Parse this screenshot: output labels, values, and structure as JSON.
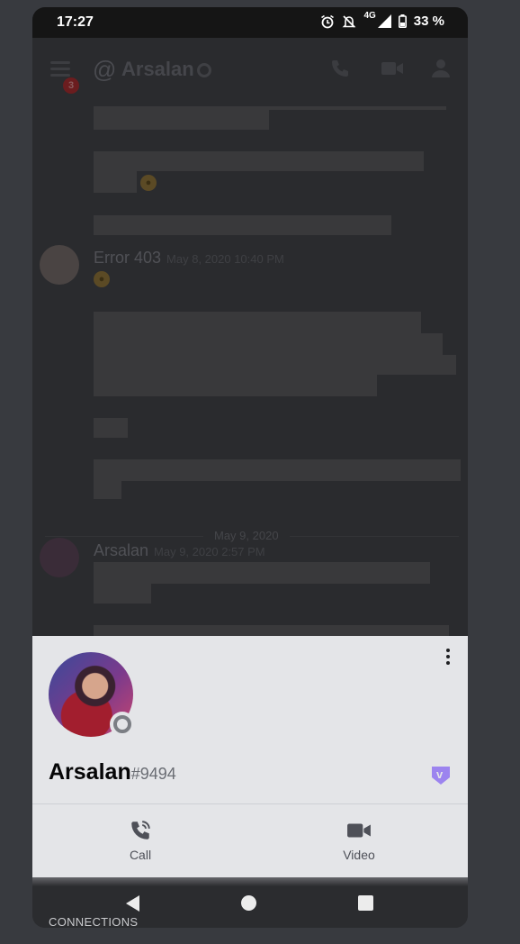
{
  "status_bar": {
    "time": "17:27",
    "network": "4G",
    "battery": "33 %"
  },
  "chat": {
    "header": {
      "at_symbol": "@",
      "channel_name": "Arsalan",
      "notification_count": "3"
    },
    "messages": [
      {
        "author": "Error 403",
        "timestamp": "May 8, 2020 10:40 PM"
      },
      {
        "author": "Arsalan",
        "timestamp": "May 9, 2020 2:57 PM"
      }
    ],
    "date_divider": "May 9, 2020"
  },
  "profile": {
    "username": "Arsalan",
    "discriminator": "#9494",
    "actions": {
      "call_label": "Call",
      "video_label": "Video"
    }
  },
  "nav": {
    "underlay_label": "CONNECTIONS"
  },
  "colors": {
    "sheet_bg": "#e4e5e8",
    "hypesquad": "#9c84ef",
    "offline": "#7b7e84"
  }
}
